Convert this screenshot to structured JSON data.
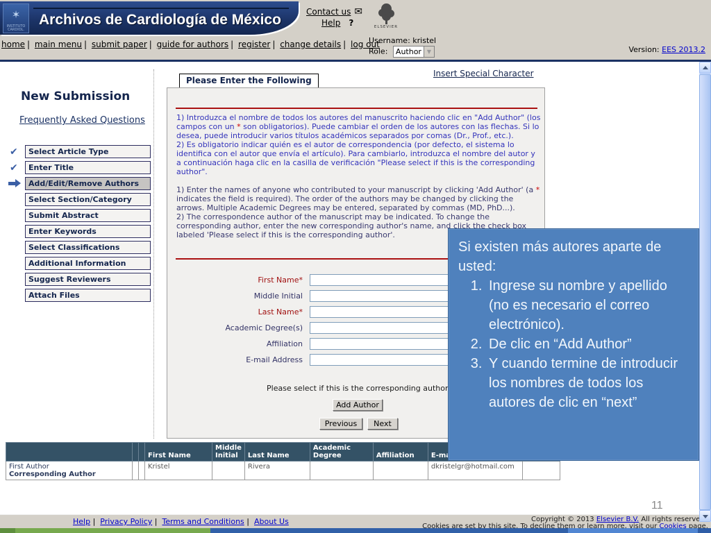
{
  "colors": {
    "accent_blue": "#4f81bd",
    "banner_navy": "#1c3468",
    "table_header": "#345266",
    "required_red": "#a01010",
    "link_blue": "#0000cc"
  },
  "header": {
    "journal_title": "Archivos de Cardiología de México",
    "contact_us": "Contact us",
    "help_label": "Help",
    "help_icon": "?",
    "elsevier_caption": "ELSEVIER",
    "username_line": "Username: kristel",
    "role_label": "Role:",
    "role_value": "Author",
    "version_label": "Version: ",
    "version_link": "EES 2013.2"
  },
  "nav": {
    "divider": "|",
    "items": [
      "home",
      "main menu",
      "submit paper",
      "guide for authors",
      "register",
      "change details",
      "log out"
    ]
  },
  "sidebar": {
    "title": "New Submission",
    "faq_link": "Frequently Asked Questions",
    "steps": [
      {
        "label": "Select Article Type",
        "status": "done"
      },
      {
        "label": "Enter Title",
        "status": "done"
      },
      {
        "label": "Add/Edit/Remove Authors",
        "status": "current"
      },
      {
        "label": "Select Section/Category",
        "status": "todo"
      },
      {
        "label": "Submit Abstract",
        "status": "todo"
      },
      {
        "label": "Enter Keywords",
        "status": "todo"
      },
      {
        "label": "Select Classifications",
        "status": "todo"
      },
      {
        "label": "Additional Information",
        "status": "todo"
      },
      {
        "label": "Suggest Reviewers",
        "status": "todo"
      },
      {
        "label": "Attach Files",
        "status": "todo"
      }
    ],
    "check_glyph": "✔"
  },
  "main": {
    "tab_label": "Please Enter the Following",
    "insert_special_character": "Insert Special Character",
    "star": "*",
    "es1a": "1) Introduzca el nombre de todos los autores del manuscrito haciendo clic en \"Add Author\" (los campos con un ",
    "es1b": " son obligatorios). Puede cambiar el orden de los autores con las flechas. Si lo desea, puede introducir varios títulos académicos separados por comas (Dr., Prof., etc.).",
    "es2": "2) Es obligatorio indicar quién es el autor de correspondencia (por defecto, el sistema lo identifica con el autor que envía el artículo). Para cambiarlo, introduzca el nombre del autor y a continuación haga clic en la casilla de verificación \"Please select if this is the corresponding author\".",
    "en1a": "1) Enter the names of anyone who contributed to your manuscript by clicking 'Add Author' (a ",
    "en1b": " indicates the field is required). The order of the authors may be changed by clicking the arrows. Multiple Academic Degrees may be entered, separated by commas (MD, PhD...).",
    "en2": "2) The correspondence author of the manuscript may be indicated. To change the corresponding author, enter the new corresponding author's name, and click the check box labeled 'Please select if this is the corresponding author'.",
    "form": {
      "fields": [
        {
          "label": "First Name*"
        },
        {
          "label": "Middle Initial"
        },
        {
          "label": "Last Name*"
        },
        {
          "label": "Academic Degree(s)"
        },
        {
          "label": "Affiliation"
        },
        {
          "label": "E-mail Address"
        }
      ],
      "corresponding_label": "Please select if this is the corresponding author",
      "add_author_button": "Add Author",
      "previous_button": "Previous",
      "next_button": "Next"
    }
  },
  "overlay": {
    "intro": "Si existen más autores aparte de usted:",
    "items": [
      "Ingrese su nombre y apellido (no es necesario el correo electrónico).",
      "De clic en “Add Author”",
      "Y cuando termine de introducir los nombres de todos los autores de clic en “next”"
    ]
  },
  "authors_table": {
    "headers": [
      "",
      "",
      "",
      "First Name",
      "Middle Initial",
      "Last Name",
      "Academic Degree",
      "Affiliation",
      "E-mail Address",
      ""
    ],
    "row": {
      "role_line1": "First Author",
      "role_line2": "Corresponding Author",
      "first_name": "Kristel",
      "middle_initial": "",
      "last_name": "Rivera",
      "academic_degree": "",
      "affiliation": "",
      "email": "dkristelgr@hotmail.com"
    }
  },
  "footer": {
    "divider": "|",
    "links": [
      "Help",
      "Privacy Policy",
      "Terms and Conditions",
      "About Us"
    ],
    "copyright_pre": "Copyright © 2013 ",
    "copyright_link": "Elsevier B.V.",
    "copyright_post": "  All rights reserved.",
    "cookies_pre": "Cookies are set by this site. To decline them or learn more, visit our ",
    "cookies_link": "Cookies",
    "cookies_post": " page.",
    "page_number": "11"
  }
}
